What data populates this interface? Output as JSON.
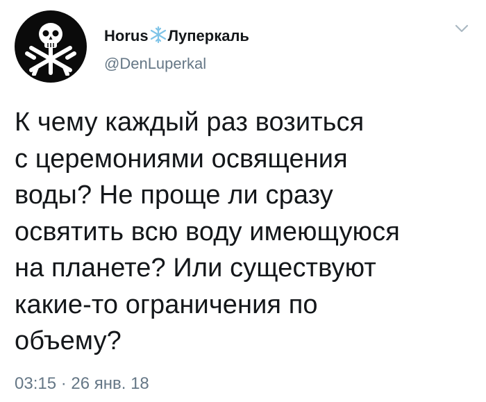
{
  "author": {
    "name_part1": "Horus",
    "name_part2": "Луперкаль",
    "handle": "@DenLuperkal",
    "avatar_icon": "skull-snowflake-icon",
    "name_icon": "snowflake-icon"
  },
  "tweet": {
    "text": "К чему каждый раз возиться\nс церемониями освящения\nводы? Не проще ли сразу\nосвятить всю воду имеющуюся\nна планете? Или существуют\nкакие-то ограничения по\nобъему?",
    "timestamp": "03:15 · 26 янв. 18"
  },
  "menu": {
    "icon": "chevron-down-icon"
  },
  "colors": {
    "text": "#14171a",
    "secondary": "#657786",
    "snowflake_accent": "#7fc4e8",
    "avatar_bg": "#0b0b0b",
    "chevron": "#aab8c2"
  }
}
